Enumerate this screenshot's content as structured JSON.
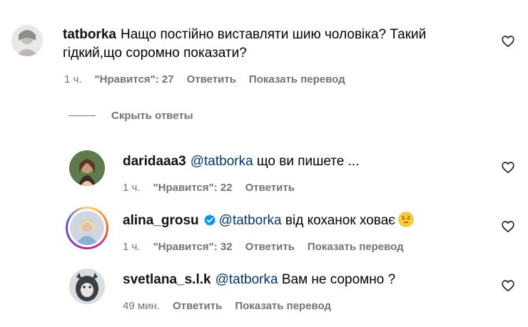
{
  "comments": [
    {
      "username": "tatborka",
      "text": "Нащо постійно виставляти шию чоловіка? Такий гідкий,що соромно показати?",
      "time": "1 ч.",
      "likes": "\"Нравится\": 27",
      "reply": "Ответить",
      "translate": "Показать перевод"
    }
  ],
  "hide_replies": "Скрыть ответы",
  "replies": [
    {
      "username": "daridaaa3",
      "mention": "@tatborka",
      "text": "що ви пишете ...",
      "time": "1 ч.",
      "likes": "\"Нравится\": 22",
      "reply": "Ответить"
    },
    {
      "username": "alina_grosu",
      "verified": true,
      "mention": "@tatborka",
      "text": "від коханок ховає",
      "emoji": "pensive-face",
      "time": "1 ч.",
      "likes": "\"Нравится\": 32",
      "reply": "Ответить",
      "translate": "Показать перевод"
    },
    {
      "username": "svetlana_s.l.k",
      "mention": "@tatborka",
      "text": "Вам не соромно ?",
      "time": "49 мин.",
      "reply": "Ответить",
      "translate": "Показать перевод"
    }
  ],
  "colors": {
    "meta": "#737373",
    "mention": "#00376b",
    "verified": "#0095f6"
  },
  "icons": [
    "heart-icon",
    "verified-badge-icon",
    "pensive-face-emoji"
  ]
}
